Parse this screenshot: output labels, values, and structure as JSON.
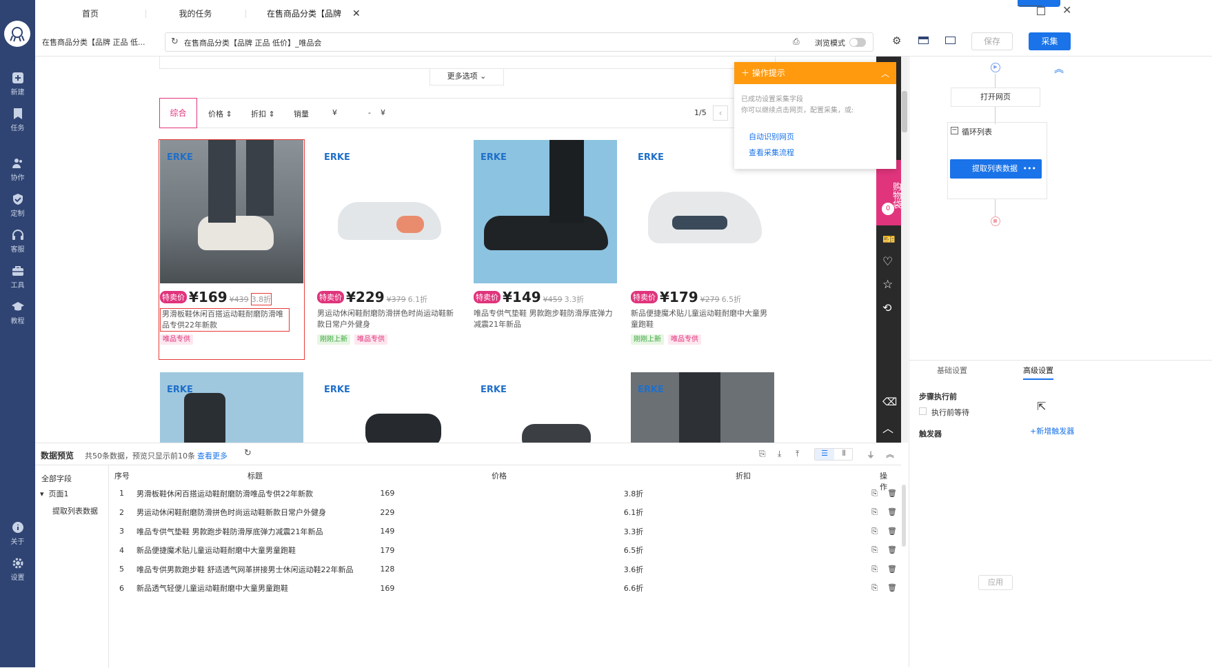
{
  "sidebar": {
    "items": [
      {
        "label": "新建",
        "icon": "plus-square-icon"
      },
      {
        "label": "任务",
        "icon": "bookmark-icon"
      },
      {
        "label": "协作",
        "icon": "users-icon"
      },
      {
        "label": "定制",
        "icon": "shield-check-icon"
      },
      {
        "label": "客服",
        "icon": "headset-icon"
      },
      {
        "label": "工具",
        "icon": "toolbox-icon"
      },
      {
        "label": "教程",
        "icon": "graduation-cap-icon"
      }
    ],
    "bottom": [
      {
        "label": "关于",
        "icon": "info-icon"
      },
      {
        "label": "设置",
        "icon": "gear-icon"
      }
    ]
  },
  "tabs": [
    {
      "label": "首页"
    },
    {
      "label": "我的任务"
    },
    {
      "label": "在售商品分类【品牌 正..."
    }
  ],
  "addr": {
    "page_label": "在售商品分类【品牌 正品 低...",
    "url": "在售商品分类【品牌 正品 低价】_唯品会",
    "browse_mode": "浏览模式",
    "save": "保存",
    "collect": "采集"
  },
  "page": {
    "more_options": "更多选项",
    "sorts": [
      "综合",
      "价格",
      "折扣",
      "销量"
    ],
    "price_from": "¥",
    "price_to": "¥",
    "price_dash": "-",
    "pager": "1/5",
    "products": [
      {
        "brand": "ERKE",
        "sale": "特卖价",
        "price": "¥169",
        "old": "¥439",
        "disc": "3.8折",
        "title": "男滑板鞋休闲百搭运动鞋耐磨防滑唯品专供22年新款",
        "tags": [
          {
            "t": "唯品专供",
            "k": "vip"
          }
        ]
      },
      {
        "brand": "ERKE",
        "sale": "特卖价",
        "price": "¥229",
        "old": "¥379",
        "disc": "6.1折",
        "title": "男运动休闲鞋耐磨防滑拼色时尚运动鞋新款日常户外健身",
        "tags": [
          {
            "t": "刚刚上新",
            "k": "new"
          },
          {
            "t": "唯品专供",
            "k": "vip"
          }
        ]
      },
      {
        "brand": "ERKE",
        "sale": "特卖价",
        "price": "¥149",
        "old": "¥459",
        "disc": "3.3折",
        "title": "唯品专供气垫鞋 男款跑步鞋防滑厚底弹力减震21年新品",
        "tags": []
      },
      {
        "brand": "ERKE",
        "sale": "特卖价",
        "price": "¥179",
        "old": "¥279",
        "disc": "6.5折",
        "title": "新品便捷魔术贴儿童运动鞋耐磨中大童男童跑鞋",
        "tags": [
          {
            "t": "刚刚上新",
            "k": "new"
          },
          {
            "t": "唯品专供",
            "k": "vip"
          }
        ]
      }
    ],
    "row2_brands": [
      "ERKE",
      "ERKE",
      "ERKE",
      "ERKE"
    ],
    "cart": "购物袋",
    "cart_count": "0"
  },
  "hint": {
    "title": "操作提示",
    "line1": "已成功设置采集字段",
    "line2": "你可以继续点击网页，配置采集，或:",
    "link1": "自动识别网页",
    "link2": "查看采集流程"
  },
  "flow": {
    "open": "打开网页",
    "loop": "循环列表",
    "extract": "提取列表数据"
  },
  "settings": {
    "tab_basic": "基础设置",
    "tab_adv": "高级设置",
    "before": "步骤执行前",
    "wait": "执行前等待",
    "trigger": "触发器",
    "add_trigger": "+新增触发器",
    "apply": "应用"
  },
  "preview": {
    "title": "数据预览",
    "summary": "共50条数据，预览只显示前10条",
    "more": "查看更多",
    "tree": {
      "all": "全部字段",
      "page": "页面1",
      "extract": "提取列表数据"
    },
    "cols": [
      "序号",
      "标题",
      "价格",
      "折扣",
      "操作"
    ],
    "rows": [
      {
        "i": "1",
        "t": "男滑板鞋休闲百搭运动鞋耐磨防滑唯品专供22年新款",
        "p": "169",
        "d": "3.8折"
      },
      {
        "i": "2",
        "t": "男运动休闲鞋耐磨防滑拼色时尚运动鞋新款日常户外健身",
        "p": "229",
        "d": "6.1折"
      },
      {
        "i": "3",
        "t": "唯品专供气垫鞋 男款跑步鞋防滑厚底弹力减震21年新品",
        "p": "149",
        "d": "3.3折"
      },
      {
        "i": "4",
        "t": "新品便捷魔术贴儿童运动鞋耐磨中大童男童跑鞋",
        "p": "179",
        "d": "6.5折"
      },
      {
        "i": "5",
        "t": "唯品专供男款跑步鞋 舒适透气网革拼接男士休闲运动鞋22年新品",
        "p": "128",
        "d": "3.6折"
      },
      {
        "i": "6",
        "t": "新品透气轻便儿童运动鞋耐磨中大童男童跑鞋",
        "p": "169",
        "d": "6.6折"
      }
    ]
  }
}
